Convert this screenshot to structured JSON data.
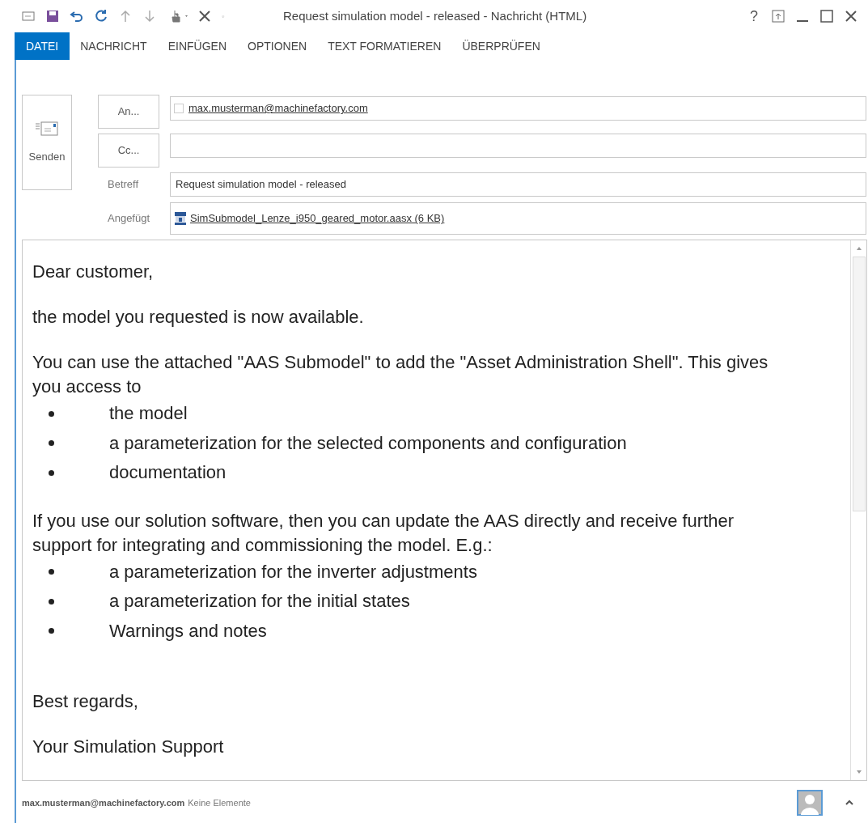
{
  "window": {
    "title": "Request simulation model - released - Nachricht (HTML)",
    "controls": [
      "?"
    ]
  },
  "ribbon_tabs": [
    {
      "label": "DATEI",
      "selected": true
    },
    {
      "label": "NACHRICHT",
      "selected": false
    },
    {
      "label": "EINFÜGEN",
      "selected": false
    },
    {
      "label": "OPTIONEN",
      "selected": false
    },
    {
      "label": "TEXT FORMATIEREN",
      "selected": false
    },
    {
      "label": "ÜBERPRÜFEN",
      "selected": false
    }
  ],
  "header": {
    "send_button": "Senden",
    "to_button": "An...",
    "to_value": "max.musterman@machinefactory.com",
    "cc_button": "Cc...",
    "subject_label": "Betreff",
    "subject_value": "Request simulation model - released",
    "attached_label": "Angefügt",
    "attachment": "SimSubmodel_Lenze_i950_geared_motor.aasx (6 KB)"
  },
  "body": [
    {
      "kind": "paragraph",
      "text": "Dear customer,"
    },
    {
      "kind": "paragraph",
      "text": "the model you requested is now available."
    },
    {
      "kind": "paragraph",
      "text": "You can use the attached \"AAS Submodel\" to add the \"Asset Administration Shell\". This gives you access to"
    },
    {
      "kind": "list",
      "items": [
        "the model",
        "a parameterization for the selected components and configuration",
        "documentation"
      ]
    },
    {
      "kind": "paragraph",
      "text": "If you use our solution software, then you can update the AAS directly and receive further support for integrating and commissioning the model. E.g.:"
    },
    {
      "kind": "list",
      "items": [
        "a parameterization for the inverter adjustments",
        "a parameterization for the initial states",
        "Warnings and notes"
      ]
    },
    {
      "kind": "spacer"
    },
    {
      "kind": "paragraph",
      "text": "Best regards,"
    },
    {
      "kind": "paragraph",
      "text": "Your Simulation Support"
    }
  ],
  "footer": {
    "sender": "max.musterman@machinefactory.com",
    "items": "Keine Elemente"
  }
}
